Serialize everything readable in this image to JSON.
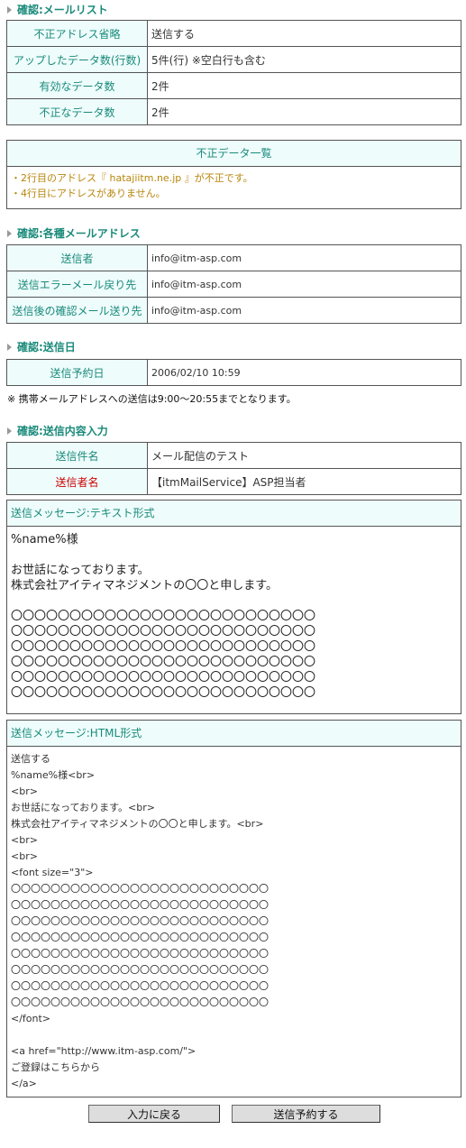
{
  "section_list": {
    "title": "確認:メールリスト",
    "rows": [
      {
        "label": "不正アドレス省略",
        "value": "送信する"
      },
      {
        "label": "アップしたデータ数(行数)",
        "value": "5件(行) ※空白行も含む"
      },
      {
        "label": "有効なデータ数",
        "value": "2件"
      },
      {
        "label": "不正なデータ数",
        "value": "2件"
      }
    ]
  },
  "invalid_data": {
    "header": "不正データ一覧",
    "lines": [
      "・2行目のアドレス『 hatajiitm.ne.jp 』が不正です。",
      "・4行目にアドレスがありません。"
    ]
  },
  "section_addresses": {
    "title": "確認:各種メールアドレス",
    "rows": [
      {
        "label": "送信者",
        "value": "info@itm-asp.com"
      },
      {
        "label": "送信エラーメール戻り先",
        "value": "info@itm-asp.com"
      },
      {
        "label": "送信後の確認メール送り先",
        "value": "info@itm-asp.com"
      }
    ]
  },
  "section_date": {
    "title": "確認:送信日",
    "rows": [
      {
        "label": "送信予約日",
        "value": "2006/02/10 10:59"
      }
    ],
    "note": "※ 携帯メールアドレスへの送信は9:00〜20:55までとなります。"
  },
  "section_content": {
    "title": "確認:送信内容入力",
    "rows": [
      {
        "label": "送信件名",
        "value": "メール配信のテスト"
      },
      {
        "label": "送信者名",
        "value": "【itmMailService】ASP担当者"
      }
    ]
  },
  "text_message": {
    "header": "送信メッセージ:テキスト形式",
    "body": "%name%様\n\nお世話になっております。\n株式会社アイティマネジメントの〇〇と申します。\n\n〇〇〇〇〇〇〇〇〇〇〇〇〇〇〇〇〇〇〇〇〇〇〇〇〇〇\n〇〇〇〇〇〇〇〇〇〇〇〇〇〇〇〇〇〇〇〇〇〇〇〇〇〇\n〇〇〇〇〇〇〇〇〇〇〇〇〇〇〇〇〇〇〇〇〇〇〇〇〇〇\n〇〇〇〇〇〇〇〇〇〇〇〇〇〇〇〇〇〇〇〇〇〇〇〇〇〇\n〇〇〇〇〇〇〇〇〇〇〇〇〇〇〇〇〇〇〇〇〇〇〇〇〇〇\n〇〇〇〇〇〇〇〇〇〇〇〇〇〇〇〇〇〇〇〇〇〇〇〇〇〇"
  },
  "html_message": {
    "header": "送信メッセージ:HTML形式",
    "body": "送信する\n%name%様<br>\n<br>\nお世話になっております。<br>\n株式会社アイティマネジメントの〇〇と申します。<br>\n<br>\n<br>\n<font size=\"3\">\n〇〇〇〇〇〇〇〇〇〇〇〇〇〇〇〇〇〇〇〇〇〇〇〇〇〇\n〇〇〇〇〇〇〇〇〇〇〇〇〇〇〇〇〇〇〇〇〇〇〇〇〇〇\n〇〇〇〇〇〇〇〇〇〇〇〇〇〇〇〇〇〇〇〇〇〇〇〇〇〇\n〇〇〇〇〇〇〇〇〇〇〇〇〇〇〇〇〇〇〇〇〇〇〇〇〇〇\n〇〇〇〇〇〇〇〇〇〇〇〇〇〇〇〇〇〇〇〇〇〇〇〇〇〇\n〇〇〇〇〇〇〇〇〇〇〇〇〇〇〇〇〇〇〇〇〇〇〇〇〇〇\n〇〇〇〇〇〇〇〇〇〇〇〇〇〇〇〇〇〇〇〇〇〇〇〇〇〇\n〇〇〇〇〇〇〇〇〇〇〇〇〇〇〇〇〇〇〇〇〇〇〇〇〇〇\n</font>\n\n<a href=\"http://www.itm-asp.com/\">\nご登録はこちらから\n</a>"
  },
  "buttons": {
    "back": "入力に戻る",
    "reserve": "送信予約する"
  },
  "colors": {
    "accent": "#1a8a7a",
    "header_bg": "#eefcfc",
    "required_label": "#cc0000",
    "error_text": "#b8860b"
  }
}
